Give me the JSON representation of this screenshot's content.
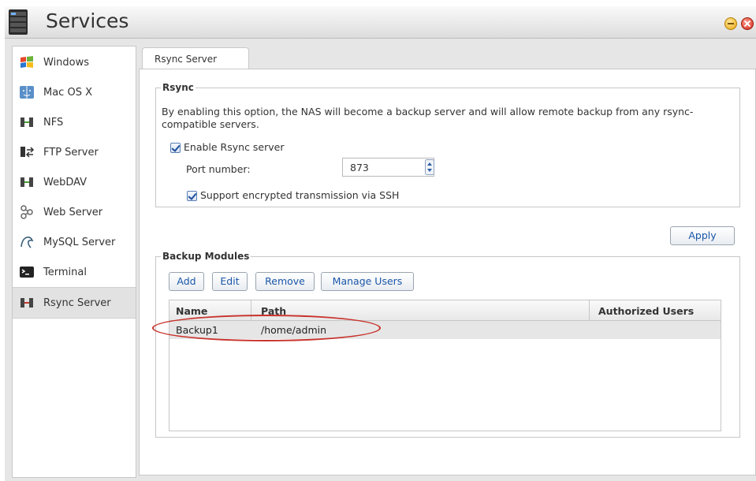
{
  "window": {
    "title": "Services"
  },
  "sidebar": {
    "items": [
      {
        "label": "Windows",
        "icon": "windows-icon"
      },
      {
        "label": "Mac OS X",
        "icon": "mac-os-x-icon"
      },
      {
        "label": "NFS",
        "icon": "nfs-icon"
      },
      {
        "label": "FTP Server",
        "icon": "ftp-server-icon"
      },
      {
        "label": "WebDAV",
        "icon": "webdav-icon"
      },
      {
        "label": "Web Server",
        "icon": "web-server-icon"
      },
      {
        "label": "MySQL Server",
        "icon": "mysql-server-icon"
      },
      {
        "label": "Terminal",
        "icon": "terminal-icon"
      },
      {
        "label": "Rsync Server",
        "icon": "rsync-server-icon",
        "active": true
      }
    ]
  },
  "tab": {
    "label": "Rsync Server"
  },
  "rsync": {
    "legend": "Rsync",
    "description": "By enabling this option, the NAS will become a backup server and will allow remote backup from any rsync-compatible servers.",
    "enable_label": "Enable Rsync server",
    "enable_checked": true,
    "port_label": "Port number:",
    "port_value": "873",
    "ssh_label": "Support encrypted transmission via SSH",
    "ssh_checked": true
  },
  "apply_label": "Apply",
  "backup": {
    "legend": "Backup Modules",
    "buttons": {
      "add": "Add",
      "edit": "Edit",
      "remove": "Remove",
      "manage_users": "Manage Users"
    },
    "columns": [
      "Name",
      "Path",
      "Authorized Users"
    ],
    "rows": [
      {
        "name": "Backup1",
        "path": "/home/admin",
        "authorized_users": ""
      }
    ]
  },
  "colors": {
    "accent_link": "#1a56a8",
    "annotation": "#c8322c"
  }
}
